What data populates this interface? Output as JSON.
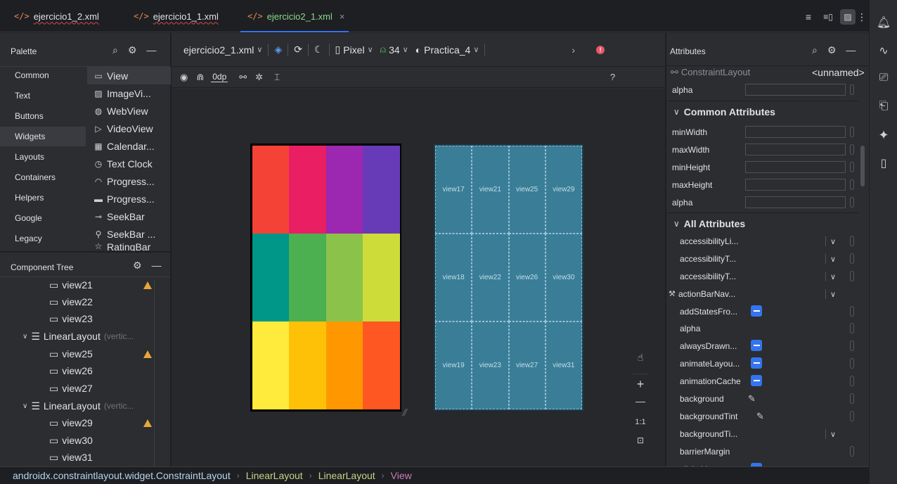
{
  "tabs": [
    {
      "label": "ejercicio1_2.xml",
      "active": false
    },
    {
      "label": "ejercicio1_1.xml",
      "active": false
    },
    {
      "label": "ejercicio2_1.xml",
      "active": true
    }
  ],
  "palette": {
    "title": "Palette",
    "categories": [
      "Common",
      "Text",
      "Buttons",
      "Widgets",
      "Layouts",
      "Containers",
      "Helpers",
      "Google",
      "Legacy"
    ],
    "selected_category": "Widgets",
    "items": [
      {
        "label": "View",
        "icon": "view-icon"
      },
      {
        "label": "ImageVi...",
        "icon": "image-icon"
      },
      {
        "label": "WebView",
        "icon": "globe-icon"
      },
      {
        "label": "VideoView",
        "icon": "video-icon"
      },
      {
        "label": "Calendar...",
        "icon": "calendar-icon"
      },
      {
        "label": "Text Clock",
        "icon": "clock-icon"
      },
      {
        "label": "Progress...",
        "icon": "progress-circle-icon"
      },
      {
        "label": "Progress...",
        "icon": "progress-bar-icon"
      },
      {
        "label": "SeekBar",
        "icon": "seekbar-icon"
      },
      {
        "label": "SeekBar ...",
        "icon": "seekbar-discrete-icon"
      },
      {
        "label": "RatingBar",
        "icon": "star-icon"
      }
    ]
  },
  "component_tree": {
    "title": "Component Tree",
    "rows": [
      {
        "label": "view21",
        "level": 2,
        "warn": true
      },
      {
        "label": "view22",
        "level": 2,
        "warn": false
      },
      {
        "label": "view23",
        "level": 2,
        "warn": false
      },
      {
        "label": "LinearLayout",
        "hint": "(vertic...",
        "level": 1,
        "layout": true
      },
      {
        "label": "view25",
        "level": 2,
        "warn": true
      },
      {
        "label": "view26",
        "level": 2,
        "warn": false
      },
      {
        "label": "view27",
        "level": 2,
        "warn": false
      },
      {
        "label": "LinearLayout",
        "hint": "(vertic...",
        "level": 1,
        "layout": true
      },
      {
        "label": "view29",
        "level": 2,
        "warn": true
      },
      {
        "label": "view30",
        "level": 2,
        "warn": false
      },
      {
        "label": "view31",
        "level": 2,
        "warn": false
      }
    ]
  },
  "editor_toolbar": {
    "file": "ejercicio2_1.xml",
    "device": "Pixel",
    "api": "34",
    "theme": "Practica_4",
    "margin": "0dp",
    "help": "?"
  },
  "design_colors": [
    [
      "#f44336",
      "#e91e63",
      "#9c27b0",
      "#673ab7"
    ],
    [
      "#009688",
      "#4caf50",
      "#8bc34a",
      "#cddc39"
    ],
    [
      "#ffeb3b",
      "#ffc107",
      "#ff9800",
      "#ff5722"
    ]
  ],
  "blueprint_labels": [
    [
      "view17",
      "view21",
      "view25",
      "view29"
    ],
    [
      "view18",
      "view22",
      "view26",
      "view30"
    ],
    [
      "view19",
      "view23",
      "view27",
      "view31"
    ]
  ],
  "zoom": {
    "ratio": "1:1"
  },
  "attributes": {
    "title": "Attributes",
    "component": "ConstraintLayout",
    "id_value": "<unnamed>",
    "top_rows": [
      "alpha"
    ],
    "common_title": "Common Attributes",
    "common_rows": [
      "minWidth",
      "maxWidth",
      "minHeight",
      "maxHeight",
      "alpha"
    ],
    "all_title": "All Attributes",
    "all_rows": [
      {
        "name": "accessibilityLi...",
        "kind": "dropdown"
      },
      {
        "name": "accessibilityT...",
        "kind": "dropdown"
      },
      {
        "name": "accessibilityT...",
        "kind": "dropdown"
      },
      {
        "name": "actionBarNav...",
        "kind": "dropdown",
        "wrench": true
      },
      {
        "name": "addStatesFro...",
        "kind": "checkbox"
      },
      {
        "name": "alpha",
        "kind": "text"
      },
      {
        "name": "alwaysDrawn...",
        "kind": "checkbox"
      },
      {
        "name": "animateLayou...",
        "kind": "checkbox"
      },
      {
        "name": "animationCache",
        "kind": "checkbox"
      },
      {
        "name": "background",
        "kind": "pen"
      },
      {
        "name": "backgroundTint",
        "kind": "pen"
      },
      {
        "name": "backgroundTi...",
        "kind": "dropdown"
      },
      {
        "name": "barrierMargin",
        "kind": "text"
      },
      {
        "name": "clickable",
        "kind": "checkbox"
      }
    ]
  },
  "status_bar": {
    "crumbs": [
      "androidx.constraintlayout.widget.ConstraintLayout",
      "LinearLayout",
      "LinearLayout",
      "View"
    ]
  }
}
